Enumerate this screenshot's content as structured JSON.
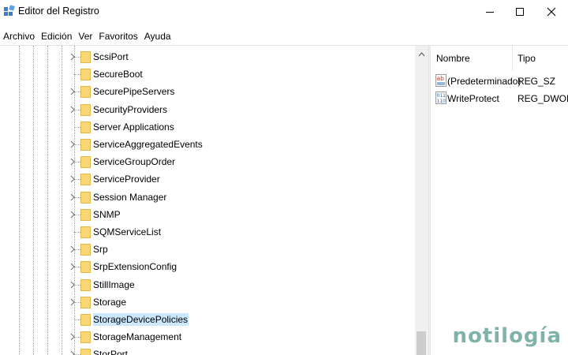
{
  "window": {
    "title": "Editor del Registro",
    "minimize_glyph": "—",
    "maximize_glyph": "☐",
    "close_glyph": "✕"
  },
  "menubar": {
    "items": [
      "Archivo",
      "Edición",
      "Ver",
      "Favoritos",
      "Ayuda"
    ]
  },
  "tree": {
    "nodes": [
      {
        "label": "ScsiPort",
        "expandable": true,
        "selected": false
      },
      {
        "label": "SecureBoot",
        "expandable": false,
        "selected": false
      },
      {
        "label": "SecurePipeServers",
        "expandable": true,
        "selected": false
      },
      {
        "label": "SecurityProviders",
        "expandable": true,
        "selected": false
      },
      {
        "label": "Server Applications",
        "expandable": false,
        "selected": false
      },
      {
        "label": "ServiceAggregatedEvents",
        "expandable": true,
        "selected": false
      },
      {
        "label": "ServiceGroupOrder",
        "expandable": true,
        "selected": false
      },
      {
        "label": "ServiceProvider",
        "expandable": true,
        "selected": false
      },
      {
        "label": "Session Manager",
        "expandable": true,
        "selected": false
      },
      {
        "label": "SNMP",
        "expandable": true,
        "selected": false
      },
      {
        "label": "SQMServiceList",
        "expandable": false,
        "selected": false
      },
      {
        "label": "Srp",
        "expandable": true,
        "selected": false
      },
      {
        "label": "SrpExtensionConfig",
        "expandable": true,
        "selected": false
      },
      {
        "label": "StillImage",
        "expandable": true,
        "selected": false
      },
      {
        "label": "Storage",
        "expandable": true,
        "selected": false
      },
      {
        "label": "StorageDevicePolicies",
        "expandable": false,
        "selected": true
      },
      {
        "label": "StorageManagement",
        "expandable": true,
        "selected": false
      },
      {
        "label": "StorPort",
        "expandable": true,
        "selected": false
      }
    ]
  },
  "values": {
    "headers": {
      "name": "Nombre",
      "type": "Tipo"
    },
    "rows": [
      {
        "name": "(Predeterminado)",
        "type": "REG_SZ",
        "icon": "string-value-icon"
      },
      {
        "name": "WriteProtect",
        "type": "REG_DWORD",
        "icon": "binary-value-icon"
      }
    ]
  },
  "watermark": "notilogía",
  "colors": {
    "selection": "#cce8ff",
    "folder": "#f8d775",
    "watermark": "#7fb3a9"
  }
}
